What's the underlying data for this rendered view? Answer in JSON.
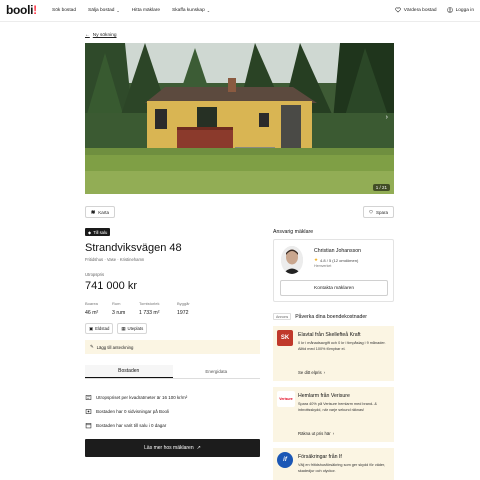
{
  "header": {
    "logo": "booli",
    "logo_mark": "!",
    "nav": [
      {
        "label": "Sök bostad"
      },
      {
        "label": "Sälja bostad",
        "chevron": "chevron-down-icon"
      },
      {
        "label": "Hitta mäklare"
      },
      {
        "label": "Skaffa kunskap",
        "chevron": "chevron-down-icon"
      }
    ],
    "saved": "Värdera bostad",
    "login": "Logga in"
  },
  "back_link": "Ny sökning",
  "hero": {
    "counter": "1 / 21"
  },
  "buttons": {
    "map": "Karta",
    "save": "Spara"
  },
  "listing": {
    "badge": "Till salu",
    "title": "Strandviksvägen 48",
    "subtitle": "Fritidshus · Vase · Kristinehamn",
    "price_label": "Utropspris",
    "price": "741 000 kr",
    "facts": [
      {
        "label": "Boarea",
        "value": "46 m²"
      },
      {
        "label": "Rum",
        "value": "3 rum"
      },
      {
        "label": "Tomtstorlek",
        "value": "1 733 m²"
      },
      {
        "label": "Byggår",
        "value": "1972"
      }
    ],
    "chips": [
      {
        "label": "Eldstad",
        "icon": "fireplace-icon"
      },
      {
        "label": "Uteplats",
        "icon": "patio-icon"
      }
    ],
    "note": "Lägg till anteckning"
  },
  "tabs": [
    {
      "label": "Bostaden",
      "active": true
    },
    {
      "label": "Energidata",
      "active": false
    }
  ],
  "info_rows": [
    {
      "text": "Utropspriset per kvadratmeter är 16 100 kr/m²",
      "icon": "price-tag-icon"
    },
    {
      "text": "Bostaden har 0 sidvisningar på Booli",
      "icon": "eye-icon"
    },
    {
      "text": "Bostaden har varit till salu i 0 dagar",
      "icon": "calendar-icon"
    }
  ],
  "read_more": "Läs mer hos mäklaren",
  "agent": {
    "section_label": "Ansvarig mäklare",
    "name": "Christian Johansson",
    "rating": "4.8 / 5 (12 omdömen)",
    "firm": "Hemverket",
    "contact": "Kontakta mäklaren"
  },
  "ads": {
    "tag": "Annons",
    "title": "Påverka dina boendekostnader",
    "items": [
      {
        "logo": "SK",
        "logo_color": "#c0392b",
        "title": "Elavtal från Skellefteå Kraft",
        "text": "0 kr i månadsavgift och 0 kr i timpåslag i 9 månader. Alltid med 100% förnybar el.",
        "link": "Se ditt elpris"
      },
      {
        "logo": "Verisure",
        "logo_color": "#e2001a",
        "title": "Hemlarm från Verisure",
        "text": "Spara 40% på Verisure hemlarm med brand- & inbrottsskydd, när varje sekund räknas!",
        "link": "Räkna ut pris här"
      },
      {
        "logo": "if",
        "logo_color": "#1b57b5",
        "title": "Försäkringar från If",
        "text": "Välj en fritidshusförsäkring som ger skydd för väder, skadedjur och olyckor.",
        "link": ""
      }
    ]
  }
}
